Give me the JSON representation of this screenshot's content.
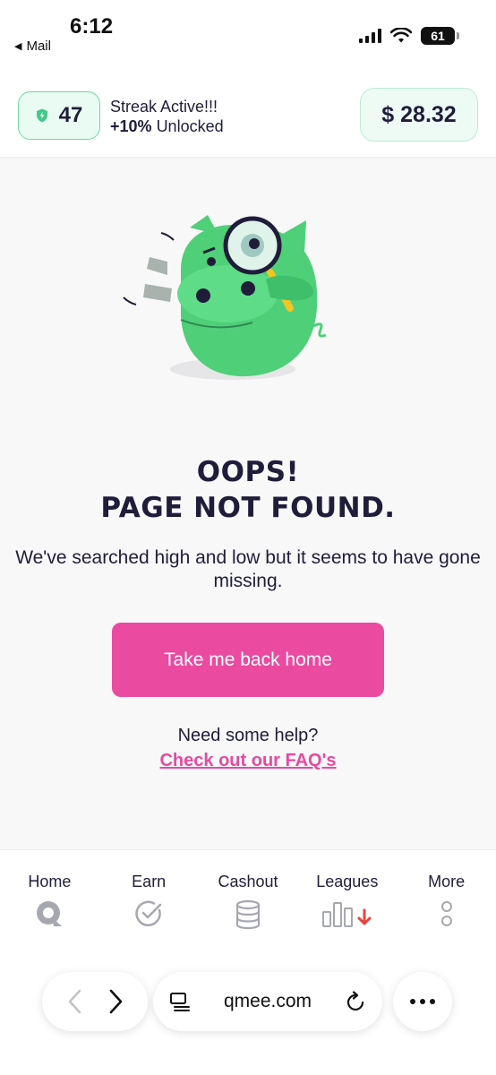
{
  "status_bar": {
    "time": "6:12",
    "back_label": "Mail",
    "battery": "61"
  },
  "header": {
    "streak_count": "47",
    "streak_title": "Streak Active!!!",
    "streak_bonus": "+10%",
    "streak_unlocked": "Unlocked",
    "balance": "$ 28.32"
  },
  "main": {
    "title_line1": "OOPS!",
    "title_line2": "PAGE NOT FOUND.",
    "description": "We've searched high and low but it seems to have gone missing.",
    "home_button": "Take me back home",
    "help_text": "Need some help?",
    "faq_link": "Check out our FAQ's"
  },
  "bottom_nav": {
    "items": [
      {
        "label": "Home",
        "icon": "home-icon"
      },
      {
        "label": "Earn",
        "icon": "check-circle-icon"
      },
      {
        "label": "Cashout",
        "icon": "coins-icon"
      },
      {
        "label": "Leagues",
        "icon": "leagues-icon"
      },
      {
        "label": "More",
        "icon": "more-vertical-icon"
      }
    ]
  },
  "browser": {
    "url": "qmee.com"
  },
  "colors": {
    "accent_pink": "#ea4aa0",
    "streak_green": "#6ed8a5",
    "text_dark": "#1f1d3a",
    "mascot_green": "#4fcf78"
  }
}
